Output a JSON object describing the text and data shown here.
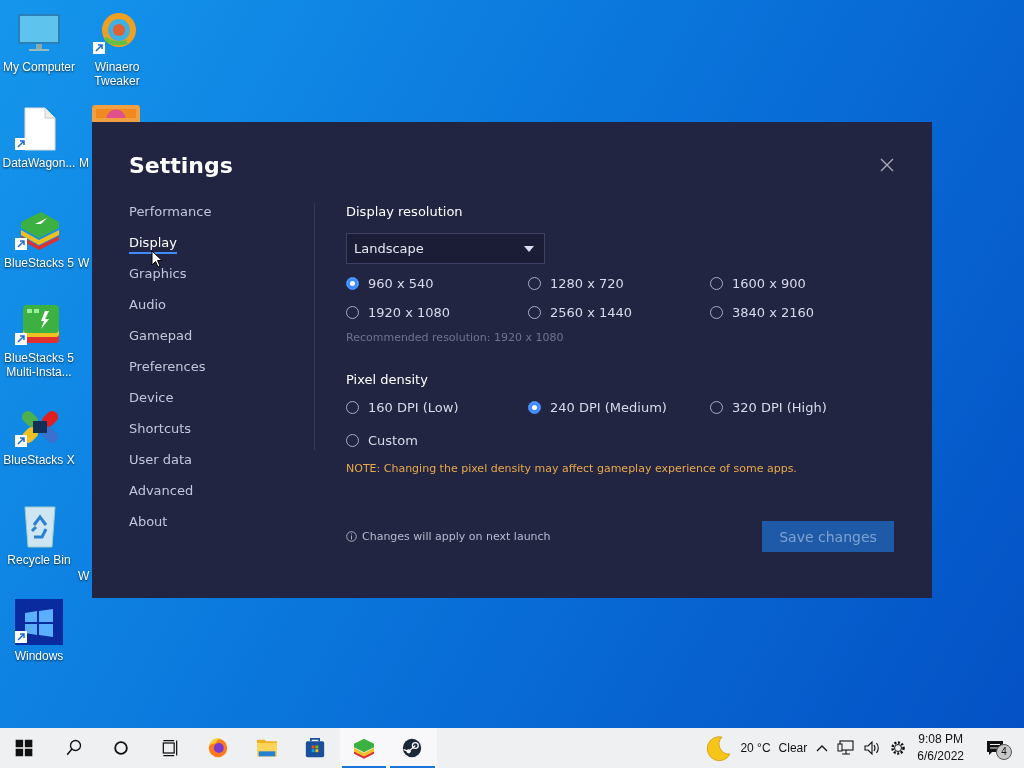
{
  "desktop": {
    "icons": [
      {
        "label": "My Computer",
        "kind": "monitor",
        "shortcut": false
      },
      {
        "label": "Winaero Tweaker",
        "kind": "winaero",
        "shortcut": true
      },
      {
        "label": "DataWagon...",
        "kind": "file",
        "shortcut": true
      },
      {
        "label": "M",
        "kind": "partial"
      },
      {
        "label": "BlueStacks 5",
        "kind": "bluestacks",
        "shortcut": true
      },
      {
        "label": "W",
        "kind": "hidden"
      },
      {
        "label": "BlueStacks 5 Multi-Insta...",
        "kind": "multi",
        "shortcut": true
      },
      {
        "label": "BlueStacks X",
        "kind": "bsx",
        "shortcut": true
      },
      {
        "label": "Recycle Bin",
        "kind": "recycle",
        "shortcut": false
      },
      {
        "label": "W",
        "kind": "hidden"
      },
      {
        "label": "Windows",
        "kind": "windows",
        "shortcut": true
      }
    ]
  },
  "settings": {
    "title": "Settings",
    "nav": [
      {
        "label": "Performance",
        "selected": false
      },
      {
        "label": "Display",
        "selected": true
      },
      {
        "label": "Graphics",
        "selected": false
      },
      {
        "label": "Audio",
        "selected": false
      },
      {
        "label": "Gamepad",
        "selected": false
      },
      {
        "label": "Preferences",
        "selected": false
      },
      {
        "label": "Device",
        "selected": false
      },
      {
        "label": "Shortcuts",
        "selected": false
      },
      {
        "label": "User data",
        "selected": false
      },
      {
        "label": "Advanced",
        "selected": false
      },
      {
        "label": "About",
        "selected": false
      }
    ],
    "resolution": {
      "heading": "Display resolution",
      "orientation": "Landscape",
      "options": [
        {
          "label": "960 x 540",
          "selected": true
        },
        {
          "label": "1280 x 720",
          "selected": false
        },
        {
          "label": "1600 x 900",
          "selected": false
        },
        {
          "label": "1920 x 1080",
          "selected": false
        },
        {
          "label": "2560 x 1440",
          "selected": false
        },
        {
          "label": "3840 x 2160",
          "selected": false
        }
      ],
      "hint": "Recommended resolution: 1920 x 1080"
    },
    "density": {
      "heading": "Pixel density",
      "options": [
        {
          "label": "160 DPI (Low)",
          "selected": false
        },
        {
          "label": "240 DPI (Medium)",
          "selected": true
        },
        {
          "label": "320 DPI (High)",
          "selected": false
        },
        {
          "label": "Custom",
          "selected": false
        }
      ],
      "note": "NOTE: Changing the pixel density may affect gameplay experience of some apps."
    },
    "footer_info": "Changes will apply on next launch",
    "save_button": {
      "label": "Save changes",
      "disabled": true
    }
  },
  "taskbar": {
    "apps": [
      {
        "kind": "start",
        "active": false
      },
      {
        "kind": "search",
        "active": false
      },
      {
        "kind": "cortana",
        "active": false
      },
      {
        "kind": "taskview",
        "active": false
      },
      {
        "kind": "firefox",
        "active": false
      },
      {
        "kind": "folder",
        "active": false
      },
      {
        "kind": "store",
        "active": false
      },
      {
        "kind": "bluestacks",
        "active": true
      },
      {
        "kind": "steam",
        "active": true
      }
    ],
    "weather": {
      "temperature": "20 °C",
      "condition": "Clear"
    },
    "clock": {
      "time": "9:08 PM",
      "date": "6/6/2022"
    },
    "notifications": "4"
  }
}
